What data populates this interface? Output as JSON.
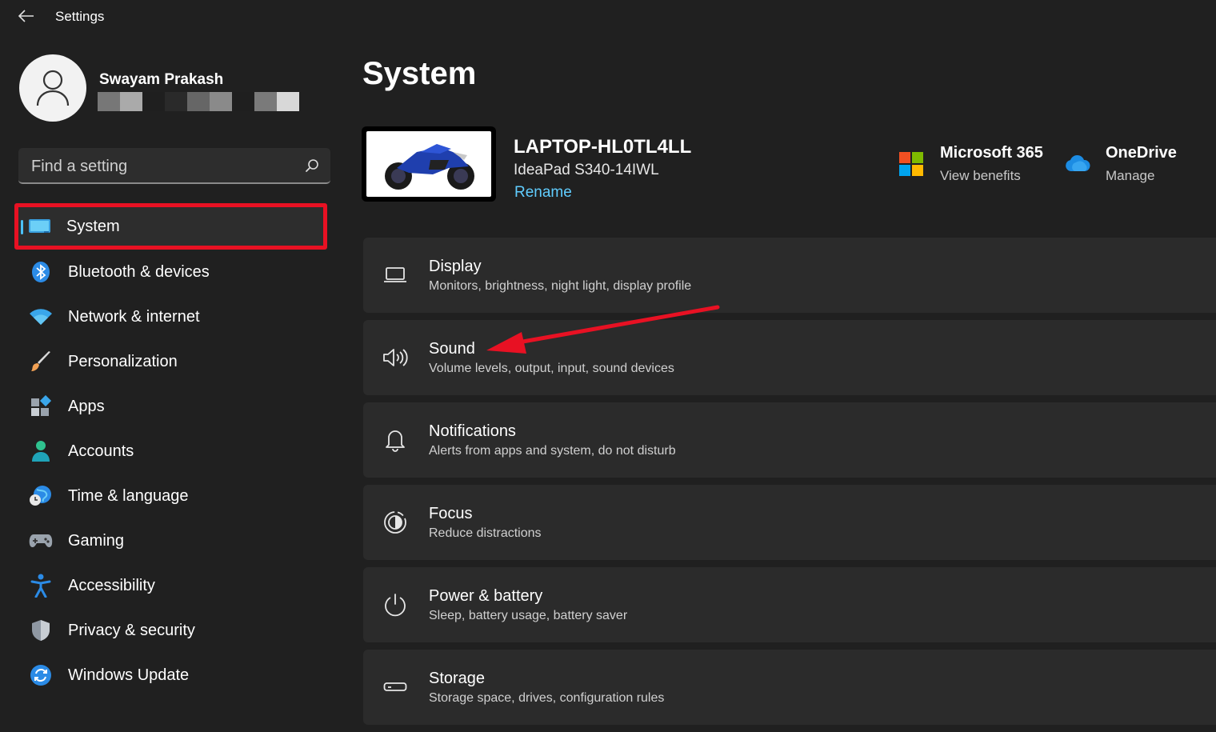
{
  "window": {
    "title": "Settings"
  },
  "profile": {
    "name": "Swayam Prakash"
  },
  "search": {
    "placeholder": "Find a setting"
  },
  "sidebar": {
    "items": [
      {
        "label": "System",
        "icon": "system-icon"
      },
      {
        "label": "Bluetooth & devices",
        "icon": "bluetooth-icon"
      },
      {
        "label": "Network & internet",
        "icon": "wifi-icon"
      },
      {
        "label": "Personalization",
        "icon": "brush-icon"
      },
      {
        "label": "Apps",
        "icon": "apps-icon"
      },
      {
        "label": "Accounts",
        "icon": "accounts-icon"
      },
      {
        "label": "Time & language",
        "icon": "time-language-icon"
      },
      {
        "label": "Gaming",
        "icon": "gamepad-icon"
      },
      {
        "label": "Accessibility",
        "icon": "accessibility-icon"
      },
      {
        "label": "Privacy & security",
        "icon": "shield-icon"
      },
      {
        "label": "Windows Update",
        "icon": "windows-update-icon"
      }
    ],
    "selected": "System"
  },
  "main": {
    "title": "System",
    "device": {
      "name": "LAPTOP-HL0TL4LL",
      "model": "IdeaPad S340-14IWL",
      "rename_label": "Rename",
      "image": "motorcycle-wallpaper"
    },
    "promos": [
      {
        "title": "Microsoft 365",
        "subtitle": "View benefits",
        "icon": "microsoft-logo-icon"
      },
      {
        "title": "OneDrive",
        "subtitle": "Manage",
        "icon": "onedrive-cloud-icon"
      }
    ],
    "cards": [
      {
        "title": "Display",
        "subtitle": "Monitors, brightness, night light, display profile",
        "icon": "monitor-icon"
      },
      {
        "title": "Sound",
        "subtitle": "Volume levels, output, input, sound devices",
        "icon": "speaker-icon"
      },
      {
        "title": "Notifications",
        "subtitle": "Alerts from apps and system, do not disturb",
        "icon": "bell-icon"
      },
      {
        "title": "Focus",
        "subtitle": "Reduce distractions",
        "icon": "focus-icon"
      },
      {
        "title": "Power & battery",
        "subtitle": "Sleep, battery usage, battery saver",
        "icon": "power-icon"
      },
      {
        "title": "Storage",
        "subtitle": "Storage space, drives, configuration rules",
        "icon": "storage-icon"
      }
    ]
  },
  "colors": {
    "background": "#202020",
    "card": "#2b2b2b",
    "accent": "#60cdff",
    "annotation_red": "#e81123"
  }
}
